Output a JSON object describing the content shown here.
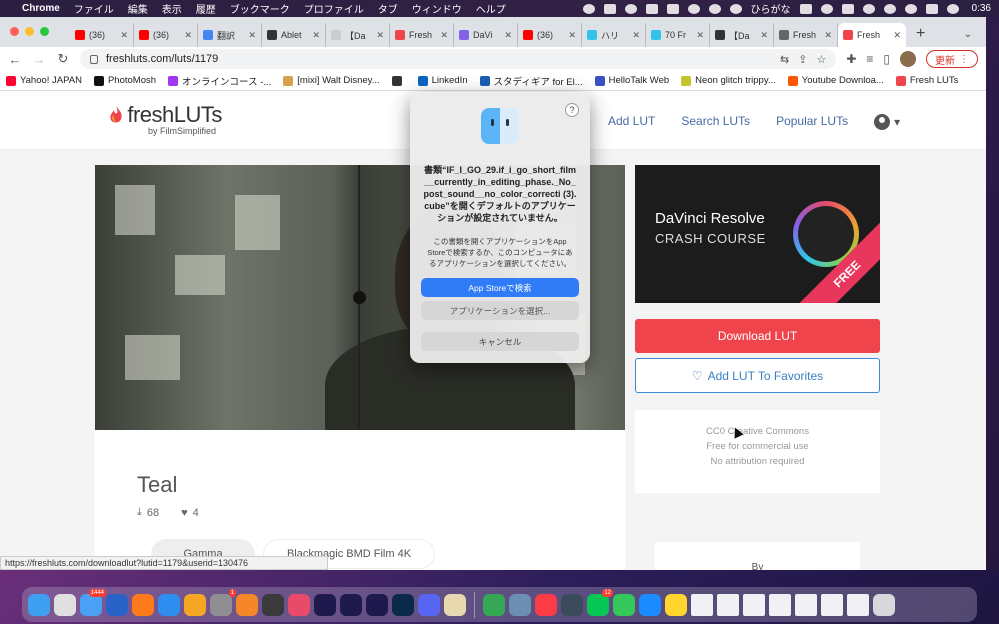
{
  "menubar": {
    "app": "Chrome",
    "items": [
      "ファイル",
      "編集",
      "表示",
      "履歴",
      "ブックマーク",
      "プロファイル",
      "タブ",
      "ウィンドウ",
      "ヘルプ"
    ],
    "input_mode": "ひらがな",
    "clock": "0:36"
  },
  "tabs": [
    {
      "label": "(36)",
      "color": "#ff0000"
    },
    {
      "label": "(36)",
      "color": "#ff0000"
    },
    {
      "label": "翻訳",
      "color": "#4285f4"
    },
    {
      "label": "Ablet",
      "color": "#333333"
    },
    {
      "label": "【Da",
      "color": "#cccccc"
    },
    {
      "label": "Fresh",
      "color": "#f0444c"
    },
    {
      "label": "DaVi",
      "color": "#8560e8"
    },
    {
      "label": "(36)",
      "color": "#ff0000"
    },
    {
      "label": "ハリ",
      "color": "#31c6e8"
    },
    {
      "label": "70 Fr",
      "color": "#31c6e8"
    },
    {
      "label": "【Da",
      "color": "#333333"
    },
    {
      "label": "Fresh",
      "color": "#666666"
    },
    {
      "label": "Fresh",
      "color": "#f0444c"
    }
  ],
  "url": "freshluts.com/luts/1179",
  "update_label": "更新",
  "bookmarks": [
    {
      "label": "Yahoo! JAPAN",
      "color": "#ff0033"
    },
    {
      "label": "PhotoMosh",
      "color": "#111111"
    },
    {
      "label": "オンラインコース -...",
      "color": "#a435f0"
    },
    {
      "label": "[mixi] Walt Disney...",
      "color": "#d4a24c"
    },
    {
      "label": "",
      "color": "#333333"
    },
    {
      "label": "LinkedIn",
      "color": "#0a66c2"
    },
    {
      "label": "スタディギア for El...",
      "color": "#1a5fb4"
    },
    {
      "label": "HelloTalk Web",
      "color": "#3b4fc4"
    },
    {
      "label": "Neon glitch trippy...",
      "color": "#c4c42c"
    },
    {
      "label": "Youtube Downloa...",
      "color": "#ff5500"
    },
    {
      "label": "Fresh LUTs",
      "color": "#f0444c"
    }
  ],
  "site": {
    "logo_fresh": "fresh",
    "logo_luts": "LUTs",
    "logo_sub": "by FilmSimplified",
    "nav": [
      "Add LUT",
      "Search LUTs",
      "Popular LUTs"
    ]
  },
  "lut": {
    "name": "Teal",
    "downloads": "68",
    "favorites": "4",
    "chip_1": "Gamma",
    "chip_2": "Blackmagic BMD Film 4K"
  },
  "ad": {
    "title": "DaVinci Resolve",
    "subtitle": "CRASH COURSE",
    "ribbon": "FREE"
  },
  "actions": {
    "download": "Download LUT",
    "favorite": "Add LUT To Favorites"
  },
  "license": {
    "line1": "CC0 Creative Commons",
    "line2": "Free for commercial use",
    "line3": "No attribution required"
  },
  "by_label": "By",
  "status_url": "https://freshluts.com/downloadlut?lutid=1179&userid=130476",
  "dialog": {
    "help": "?",
    "title": "書類“IF_I_GO_29.if_i_go_short_film__currently_in_editing_phase._No_post_sound__no_color_correcti (3).cube”を開くデフォルトのアプリケーションが設定されていません。",
    "body": "この書類を開くアプリケーションをApp Storeで検索するか、このコンピュータにあるアプリケーションを選択してください。",
    "btn_search": "App Storeで検索",
    "btn_choose": "アプリケーションを選択...",
    "btn_cancel": "キャンセル"
  },
  "dock": {
    "mail_badge": "1444",
    "settings_badge": "1",
    "line_badge": "12",
    "icons": [
      {
        "name": "finder",
        "color": "#3ea0f0"
      },
      {
        "name": "launchpad",
        "color": "#e0e0e0"
      },
      {
        "name": "mail",
        "color": "#4aa0f5"
      },
      {
        "name": "firefox-dev",
        "color": "#2a63c8"
      },
      {
        "name": "firefox",
        "color": "#ff7a1a"
      },
      {
        "name": "keynote",
        "color": "#2d8ef0"
      },
      {
        "name": "pages",
        "color": "#f5a623"
      },
      {
        "name": "system-settings",
        "color": "#8e8e93"
      },
      {
        "name": "blender",
        "color": "#f5862a"
      },
      {
        "name": "davinci-resolve",
        "color": "#3a3a3a"
      },
      {
        "name": "creative-cloud",
        "color": "#e84b6a"
      },
      {
        "name": "after-effects",
        "color": "#1f1a4d"
      },
      {
        "name": "premiere",
        "color": "#1f1a4d"
      },
      {
        "name": "media-encoder",
        "color": "#1f1a4d"
      },
      {
        "name": "photoshop",
        "color": "#0b2a4a"
      },
      {
        "name": "discord",
        "color": "#5865f2"
      },
      {
        "name": "preview",
        "color": "#e8d8b0"
      },
      {
        "name": "chrome",
        "color": "#34a853"
      },
      {
        "name": "finder-window",
        "color": "#6c8eb0"
      },
      {
        "name": "music",
        "color": "#fc3c44"
      },
      {
        "name": "quicktime",
        "color": "#3b4a5a"
      },
      {
        "name": "line",
        "color": "#06c755"
      },
      {
        "name": "messages",
        "color": "#34c759"
      },
      {
        "name": "safari",
        "color": "#1a8cff"
      },
      {
        "name": "notes",
        "color": "#ffd52e"
      }
    ]
  }
}
